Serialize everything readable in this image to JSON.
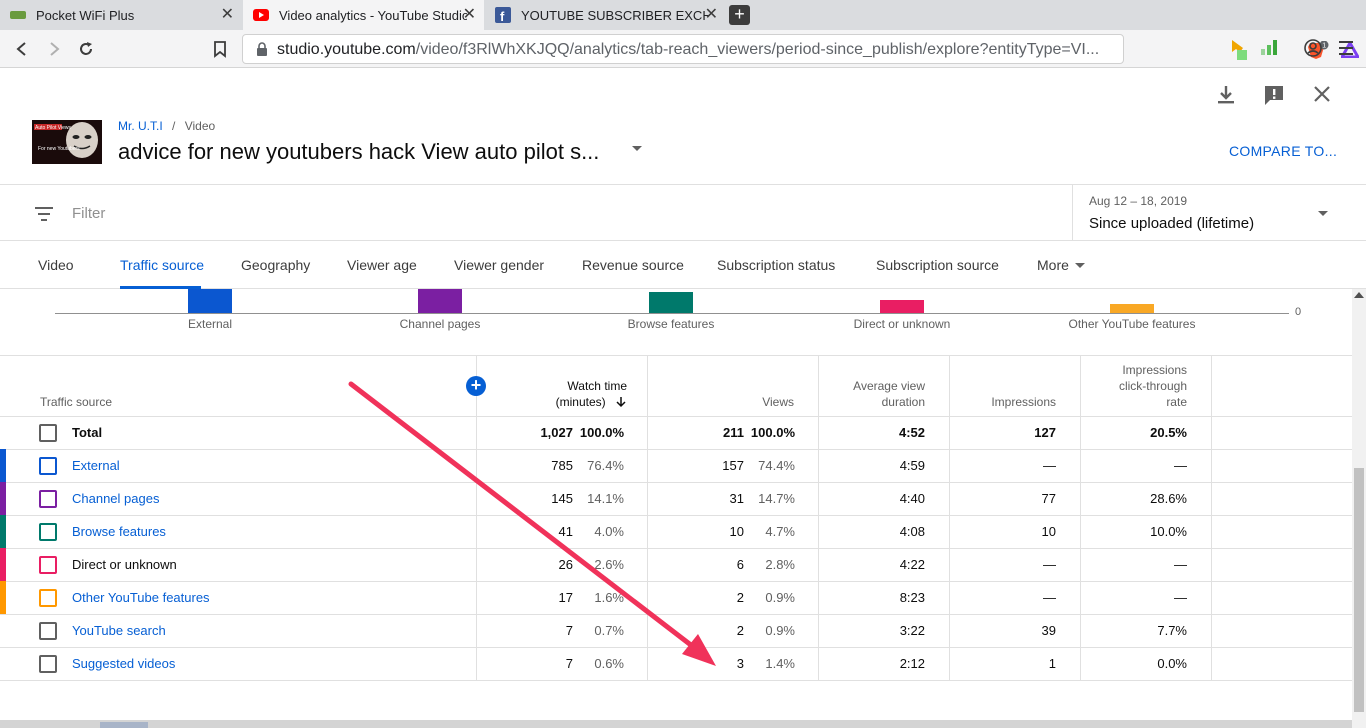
{
  "browser": {
    "tabs": [
      {
        "title": "Pocket WiFi Plus",
        "icon": "pocket-wifi-favicon"
      },
      {
        "title": "Video analytics - YouTube Studio",
        "icon": "youtube-favicon",
        "active": true
      },
      {
        "title": "YOUTUBE SUBSCRIBER EXCHANGE",
        "icon": "facebook-favicon"
      }
    ],
    "new_tab": "+",
    "url_host": "studio.youtube.com",
    "url_path": "/video/f3RlWhXKJQQ/analytics/tab-reach_viewers/period-since_publish/explore?entityType=VI...",
    "brave_badge": "1"
  },
  "header": {
    "channel": "Mr. U.T.I",
    "separator": "/",
    "crumb_video": "Video",
    "title": "advice for new youtubers hack View auto pilot s...",
    "compare": "COMPARE TO...",
    "thumb_text_1": "Auto Pilot Views",
    "thumb_text_2": "For new Youtubers"
  },
  "filter": {
    "placeholder": "Filter",
    "period_range": "Aug 12 – 18, 2019",
    "period_label": "Since uploaded (lifetime)"
  },
  "tabs": [
    "Video",
    "Traffic source",
    "Geography",
    "Viewer age",
    "Viewer gender",
    "Revenue source",
    "Subscription status",
    "Subscription source",
    "More"
  ],
  "chart": {
    "zero_label": "0",
    "bars": [
      {
        "label": "External",
        "color": "#0b57d0",
        "value": 785
      },
      {
        "label": "Channel pages",
        "color": "#7b1fa2",
        "value": 145
      },
      {
        "label": "Browse features",
        "color": "#00796b",
        "value": 41
      },
      {
        "label": "Direct or unknown",
        "color": "#e91e63",
        "value": 26
      },
      {
        "label": "Other YouTube features",
        "color": "#f9a825",
        "value": 17
      }
    ]
  },
  "table": {
    "headers": {
      "source": "Traffic source",
      "watch_time_1": "Watch time",
      "watch_time_2": "(minutes)",
      "views": "Views",
      "avd_1": "Average view",
      "avd_2": "duration",
      "impressions": "Impressions",
      "ctr_1": "Impressions",
      "ctr_2": "click-through",
      "ctr_3": "rate"
    },
    "rows": [
      {
        "name": "Total",
        "wt": "1,027",
        "wt_pct": "100.0%",
        "views": "211",
        "views_pct": "100.0%",
        "avd": "4:52",
        "imp": "127",
        "ctr": "20.5%",
        "color": ""
      },
      {
        "name": "External",
        "wt": "785",
        "wt_pct": "76.4%",
        "views": "157",
        "views_pct": "74.4%",
        "avd": "4:59",
        "imp": "—",
        "ctr": "—",
        "color": "#0b57d0"
      },
      {
        "name": "Channel pages",
        "wt": "145",
        "wt_pct": "14.1%",
        "views": "31",
        "views_pct": "14.7%",
        "avd": "4:40",
        "imp": "77",
        "ctr": "28.6%",
        "color": "#7b1fa2"
      },
      {
        "name": "Browse features",
        "wt": "41",
        "wt_pct": "4.0%",
        "views": "10",
        "views_pct": "4.7%",
        "avd": "4:08",
        "imp": "10",
        "ctr": "10.0%",
        "color": "#00796b"
      },
      {
        "name": "Direct or unknown",
        "wt": "26",
        "wt_pct": "2.6%",
        "views": "6",
        "views_pct": "2.8%",
        "avd": "4:22",
        "imp": "—",
        "ctr": "—",
        "color": "#e91e63"
      },
      {
        "name": "Other YouTube features",
        "wt": "17",
        "wt_pct": "1.6%",
        "views": "2",
        "views_pct": "0.9%",
        "avd": "8:23",
        "imp": "—",
        "ctr": "—",
        "color": "#ff9800"
      },
      {
        "name": "YouTube search",
        "wt": "7",
        "wt_pct": "0.7%",
        "views": "2",
        "views_pct": "0.9%",
        "avd": "3:22",
        "imp": "39",
        "ctr": "7.7%",
        "color": ""
      },
      {
        "name": "Suggested videos",
        "wt": "7",
        "wt_pct": "0.6%",
        "views": "3",
        "views_pct": "1.4%",
        "avd": "2:12",
        "imp": "1",
        "ctr": "0.0%",
        "color": ""
      }
    ]
  },
  "annotation_color": "#f0325a"
}
